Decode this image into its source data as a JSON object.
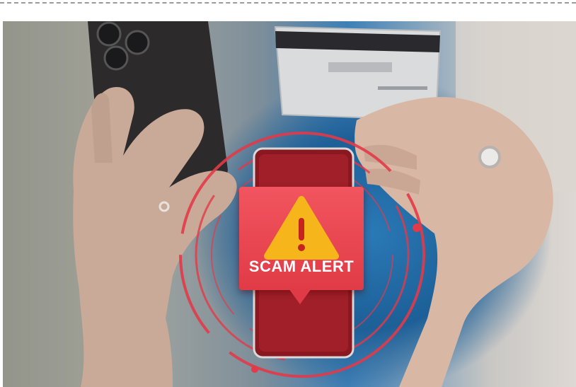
{
  "alert": {
    "label": "SCAM ALERT",
    "icon": "warning-triangle-icon"
  },
  "colors": {
    "alert_red": "#e7434d",
    "warning_yellow": "#f6b51b",
    "ring_red": "#e23a48",
    "shirt_blue": "#2a79b6"
  }
}
